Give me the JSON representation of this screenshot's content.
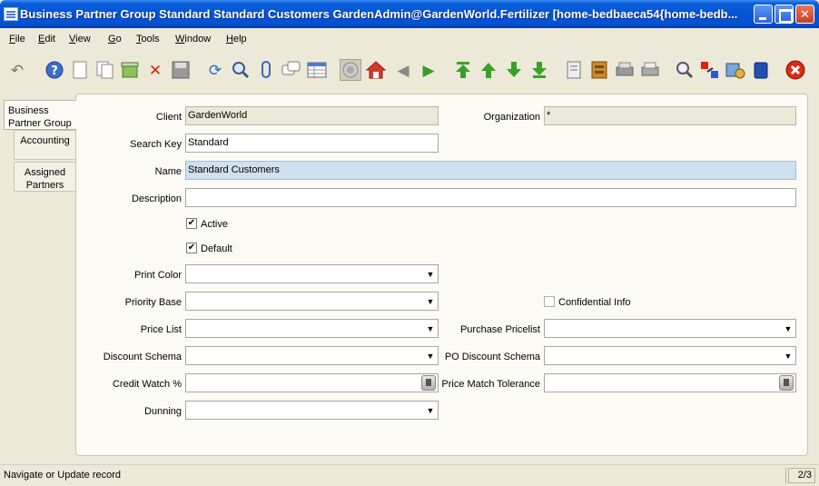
{
  "window": {
    "title": "Business Partner Group  Standard  Standard Customers  GardenAdmin@GardenWorld.Fertilizer [home-bedbaeca54{home-bedb..."
  },
  "menu": [
    "File",
    "Edit",
    "View",
    "Go",
    "Tools",
    "Window",
    "Help"
  ],
  "tabs": [
    {
      "label": "Business Partner Group",
      "active": true
    },
    {
      "label": "Accounting",
      "active": false
    },
    {
      "label": "Assigned Partners",
      "active": false
    }
  ],
  "form": {
    "client": {
      "label": "Client",
      "value": "GardenWorld"
    },
    "organization": {
      "label": "Organization",
      "value": "*"
    },
    "search_key": {
      "label": "Search Key",
      "value": "Standard"
    },
    "name": {
      "label": "Name",
      "value": "Standard Customers"
    },
    "description": {
      "label": "Description",
      "value": ""
    },
    "active": {
      "label": "Active",
      "checked": true,
      "mark": "✔"
    },
    "default": {
      "label": "Default",
      "checked": true,
      "mark": "✔"
    },
    "print_color": {
      "label": "Print Color",
      "value": ""
    },
    "priority_base": {
      "label": "Priority Base",
      "value": ""
    },
    "confidential_info": {
      "label": "Confidential Info",
      "checked": false
    },
    "price_list": {
      "label": "Price List",
      "value": ""
    },
    "purchase_pricelist": {
      "label": "Purchase Pricelist",
      "value": ""
    },
    "discount_schema": {
      "label": "Discount Schema",
      "value": ""
    },
    "po_discount_schema": {
      "label": "PO Discount Schema",
      "value": ""
    },
    "credit_watch": {
      "label": "Credit Watch %",
      "value": ""
    },
    "price_match_tolerance": {
      "label": "Price Match Tolerance",
      "value": ""
    },
    "dunning": {
      "label": "Dunning",
      "value": ""
    }
  },
  "status": {
    "message": "Navigate or Update record",
    "record": "2/3"
  },
  "colors": {
    "titlebar": "#0653d6",
    "readonly_field": "#ece9d8",
    "highlight_field": "#cfe0f0",
    "panel": "#fbfaf5"
  }
}
